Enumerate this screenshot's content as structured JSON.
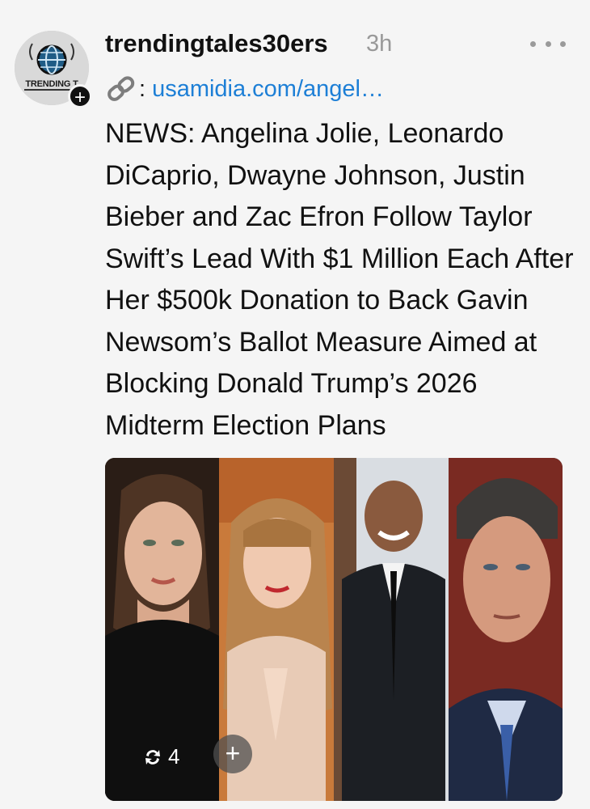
{
  "post": {
    "username": "trendingtales30ers",
    "timestamp": "3h",
    "avatar_text": "TRENDING T",
    "link_prefix": ":",
    "link_url": "usamidia.com/angel…",
    "text": "NEWS: Angelina Jolie, Leonardo DiCaprio, Dwayne Johnson, Justin Bieber and Zac Efron Follow Taylor Swift’s Lead With $1 Million Each After Her $500k Donation to Back Gavin Newsom’s Ballot Measure Aimed at Blocking Donald Trump’s 2026 Midterm Election Plans"
  },
  "media": {
    "repost_count": "4",
    "add_label": "+"
  },
  "icons": {
    "link": "link-icon",
    "more": "more-icon",
    "follow": "plus-icon",
    "repost": "repost-icon"
  },
  "colors": {
    "link": "#1d7fd6",
    "text": "#111111",
    "muted": "#999999",
    "background": "#f5f5f5"
  }
}
